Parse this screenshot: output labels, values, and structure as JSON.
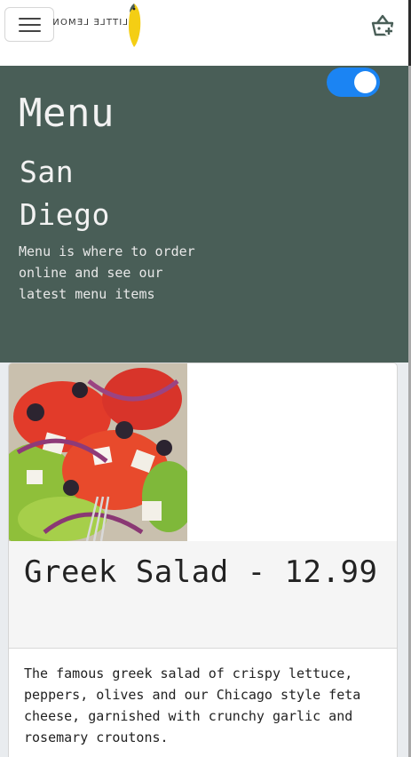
{
  "nav": {
    "menu_icon": "hamburger-icon",
    "logo_text": "LITTLE LEMON",
    "cart_icon": "basket-add-icon"
  },
  "hero": {
    "title": "Menu",
    "location": "San Diego",
    "description": "Menu is where to order online and see our latest menu items",
    "toggle_on": true
  },
  "card": {
    "image": "greek-salad-photo",
    "title": "Greek Salad - 12.99",
    "description": "The famous greek salad of crispy lettuce, peppers, olives and our Chicago style feta cheese, garnished with crunchy garlic and rosemary croutons."
  },
  "colors": {
    "hero_bg": "#495e57",
    "toggle_on": "#1b84f3",
    "lemon": "#f4ce14"
  }
}
